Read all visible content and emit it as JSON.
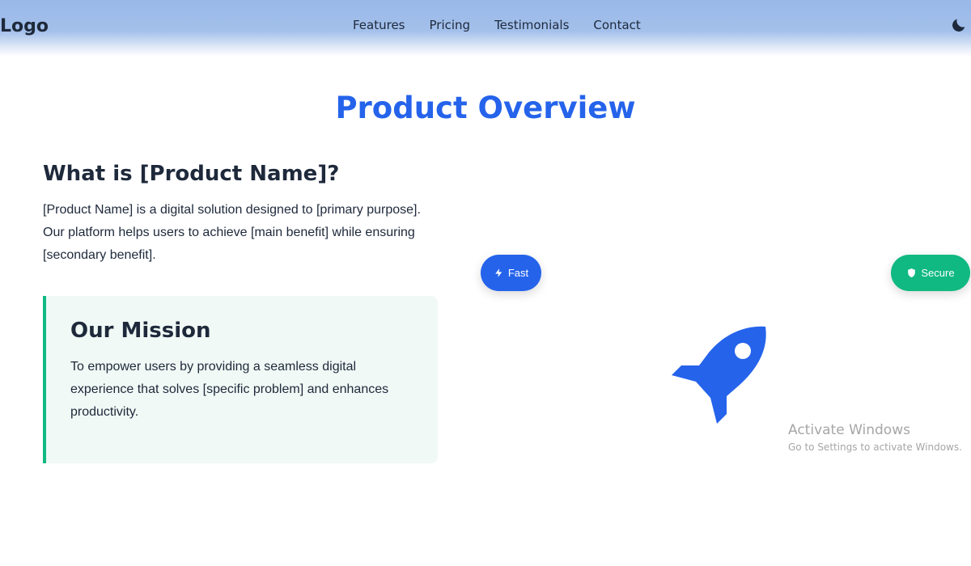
{
  "navbar": {
    "logo": "Logo",
    "links": [
      "Features",
      "Pricing",
      "Testimonials",
      "Contact"
    ],
    "theme_icon": "moon-icon"
  },
  "overview": {
    "title": "Product Overview",
    "what_heading": "What is [Product Name]?",
    "what_description": "[Product Name] is a digital solution designed to [primary purpose]. Our platform helps users to achieve [main benefit] while ensuring [secondary benefit].",
    "mission": {
      "heading": "Our Mission",
      "description": "To empower users by providing a seamless digital experience that solves [specific problem] and enhances productivity."
    },
    "badges": [
      {
        "label": "Fast",
        "icon": "bolt-icon",
        "color": "#2563eb"
      },
      {
        "label": "Secure",
        "icon": "shield-icon",
        "color": "#10b981"
      }
    ],
    "hero_icon": "rocket-icon"
  },
  "watermark": {
    "title": "Activate Windows",
    "subtitle": "Go to Settings to activate Windows."
  },
  "colors": {
    "accent": "#2563eb",
    "success": "#10b981",
    "text": "#1e293b"
  }
}
